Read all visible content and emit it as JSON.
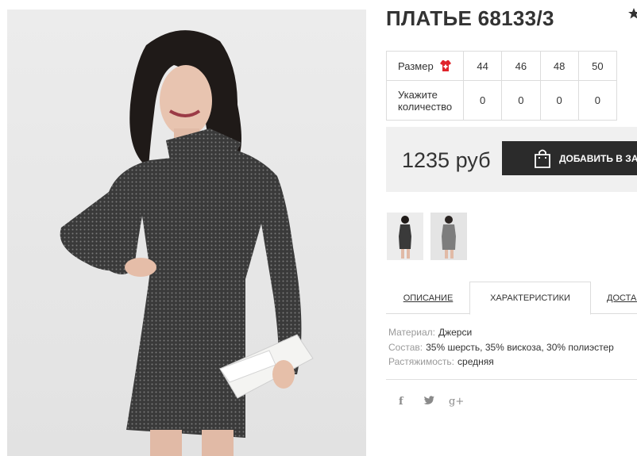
{
  "product": {
    "title": "ПЛАТЬЕ 68133/3",
    "image_alt": "dress photo"
  },
  "size_table": {
    "size_label": "Размер",
    "quantity_label": "Укажите количество",
    "sizes": [
      "44",
      "46",
      "48",
      "50"
    ],
    "quantities": [
      "0",
      "0",
      "0",
      "0"
    ]
  },
  "buy": {
    "price": "1235 руб",
    "add_to_cart_label": "ДОБАВИТЬ В ЗАКАЗ"
  },
  "tabs": [
    {
      "label": "ОПИСАНИЕ",
      "active": false
    },
    {
      "label": "ХАРАКТЕРИСТИКИ",
      "active": true
    },
    {
      "label": "ДОСТАВКА",
      "active": false
    }
  ],
  "specs": [
    {
      "key": "Материал:",
      "value": "Джерси"
    },
    {
      "key": "Состав:",
      "value": "35% шерсть, 35% вискоза, 30% полиэстер"
    },
    {
      "key": "Растяжимость:",
      "value": "средняя"
    }
  ],
  "social": {
    "facebook": "f",
    "twitter": "🐦",
    "google_plus": "g+"
  },
  "icons": {
    "size_chart": "dress-size-icon",
    "cart": "shopping-bag-icon",
    "favorite": "star-icon"
  },
  "colors": {
    "accent_red": "#e0242b",
    "button_bg": "#2b2b2b",
    "buy_box_bg": "#f0f0f0"
  }
}
